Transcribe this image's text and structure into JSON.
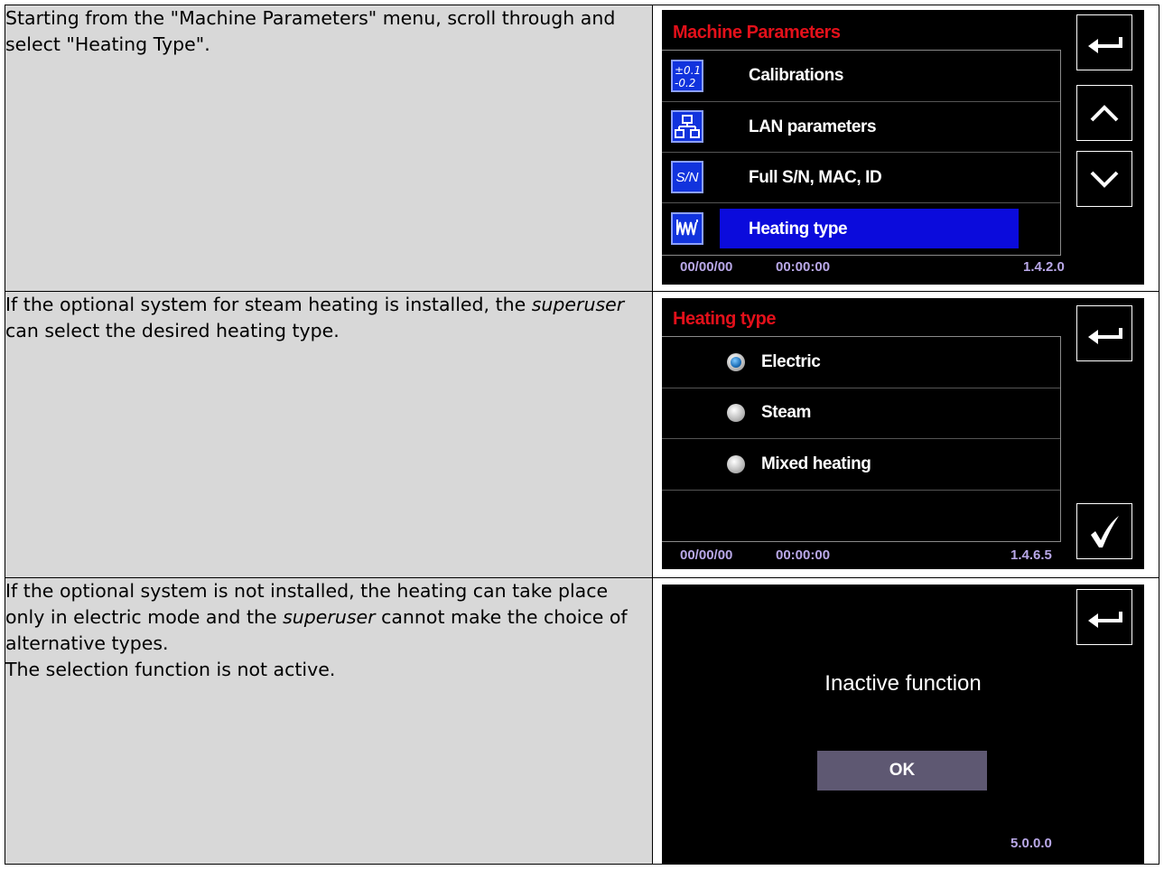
{
  "rows": [
    {
      "paragraphs": [
        "Starting from the \"Machine Parameters\" menu, scroll through and select \"Heating Type\"."
      ],
      "screen": {
        "title": "Machine Parameters",
        "items": [
          {
            "label": "Calibrations",
            "icon": "calibration-icon",
            "selected": false
          },
          {
            "label": "LAN parameters",
            "icon": "network-icon",
            "selected": false
          },
          {
            "label": "Full S/N, MAC, ID",
            "icon": "serial-number-icon",
            "icon_text": "S/N",
            "selected": false
          },
          {
            "label": "Heating type",
            "icon": "heating-coil-icon",
            "selected": true
          }
        ],
        "date": "00/00/00",
        "time": "00:00:00",
        "version": "1.4.2.0",
        "buttons": [
          "back-icon",
          "arrow-up-icon",
          "arrow-down-icon"
        ]
      }
    },
    {
      "paragraph_parts": [
        "If the optional system for steam heating is installed, the ",
        "superuser",
        " can select the desired heating type."
      ],
      "screen": {
        "title": "Heating type",
        "options": [
          {
            "label": "Electric",
            "selected": true
          },
          {
            "label": "Steam",
            "selected": false
          },
          {
            "label": "Mixed heating",
            "selected": false
          }
        ],
        "date": "00/00/00",
        "time": "00:00:00",
        "version": "1.4.6.5",
        "buttons": [
          "back-icon",
          "checkmark-icon"
        ]
      }
    },
    {
      "paragraph_parts": [
        "If the optional system is not installed, the heating can take place only in electric mode and the ",
        "superuser",
        " cannot make the choice of alternative types."
      ],
      "paragraph2": "The selection function is not active.",
      "screen": {
        "message": "Inactive function",
        "ok_label": "OK",
        "version": "5.0.0.0",
        "buttons": [
          "back-icon"
        ]
      }
    }
  ],
  "colors": {
    "title_red": "#e3101a",
    "highlight_blue": "#0b0bdc",
    "footer_lilac": "#b9a8e8",
    "ok_button": "#5e5872",
    "text_cell": "#d8d8d8"
  }
}
